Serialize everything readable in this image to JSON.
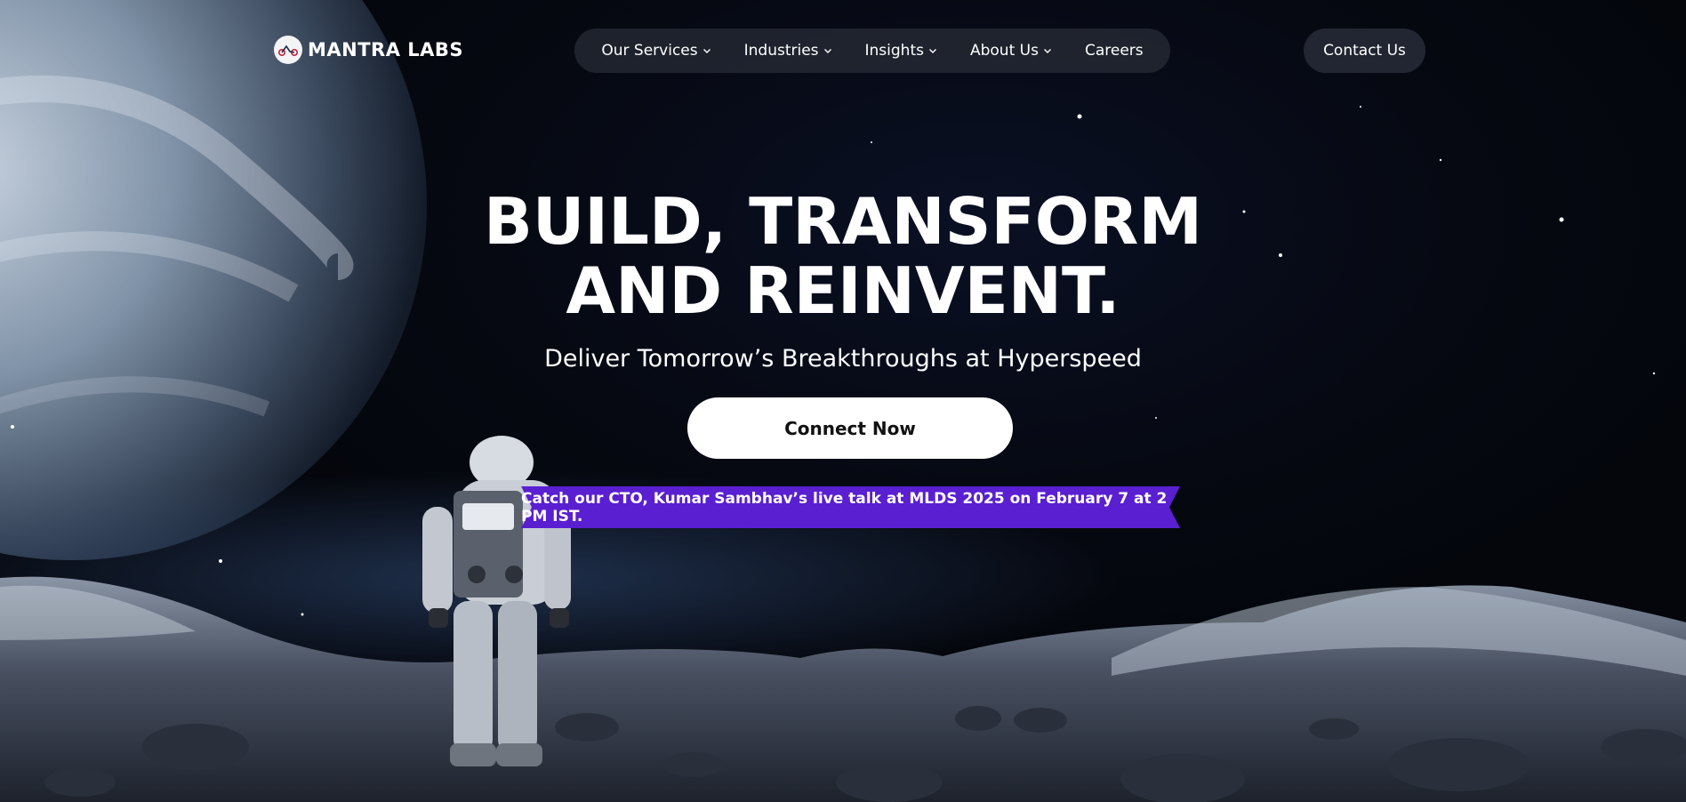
{
  "brand": {
    "name": "MANTRA LABS"
  },
  "nav": {
    "items": [
      {
        "label": "Our Services",
        "dropdown": true
      },
      {
        "label": "Industries",
        "dropdown": true
      },
      {
        "label": "Insights",
        "dropdown": true
      },
      {
        "label": "About Us",
        "dropdown": true
      },
      {
        "label": "Careers",
        "dropdown": false
      }
    ],
    "contact_label": "Contact Us"
  },
  "hero": {
    "title_line1": "BUILD, TRANSFORM",
    "title_line2": "AND REINVENT.",
    "subtitle": "Deliver Tomorrow’s Breakthroughs at Hyperspeed",
    "cta_label": "Connect Now"
  },
  "announcement": {
    "text": "Catch our CTO, Kumar Sambhav’s live talk at MLDS 2025 on February 7 at 2 PM IST.",
    "color": "#5a1fd1"
  },
  "icons": {
    "chevron": "chevron-down-icon",
    "logo": "mantra-logo-icon"
  }
}
